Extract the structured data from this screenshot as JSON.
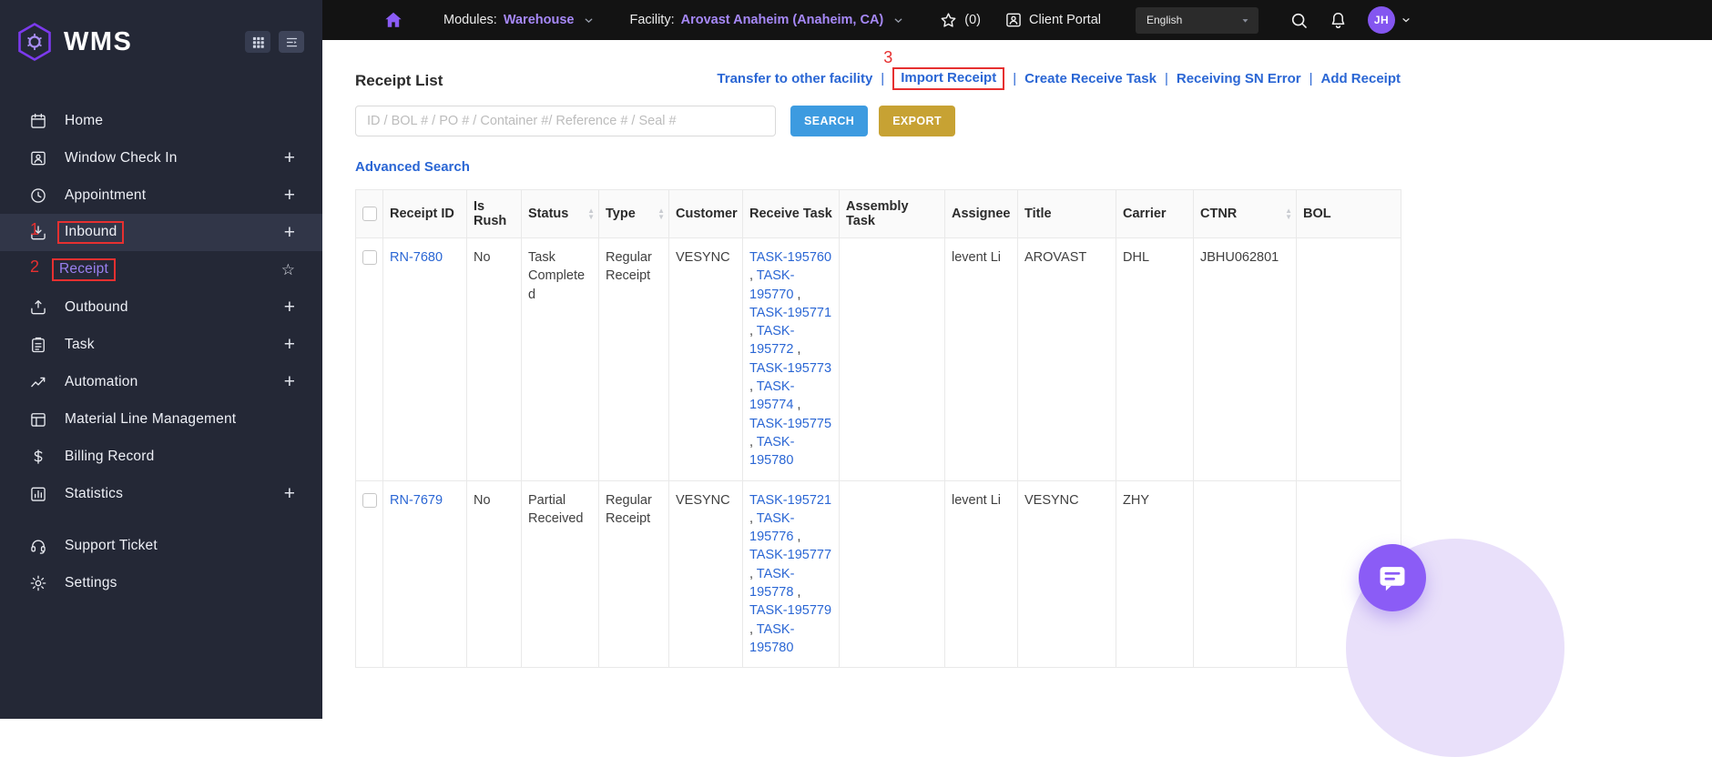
{
  "brand": {
    "name": "WMS"
  },
  "topbar": {
    "modules_label": "Modules:",
    "modules_value": "Warehouse",
    "facility_label": "Facility:",
    "facility_value": "Arovast Anaheim (Anaheim, CA)",
    "favorites_count": "(0)",
    "client_portal_label": "Client Portal",
    "language_selected": "English",
    "user_initials": "JH"
  },
  "sidebar": {
    "items": [
      {
        "label": "Home",
        "icon": "calendar-icon"
      },
      {
        "label": "Window Check In",
        "icon": "window-check-in-icon",
        "plus": true
      },
      {
        "label": "Appointment",
        "icon": "clock-icon",
        "plus": true
      },
      {
        "label": "Inbound",
        "icon": "inbound-icon",
        "plus": true,
        "active": true,
        "annotation": "1"
      },
      {
        "label": "Receipt",
        "sub": true,
        "star": true,
        "annotation": "2"
      },
      {
        "label": "Outbound",
        "icon": "outbound-icon",
        "plus": true
      },
      {
        "label": "Task",
        "icon": "task-icon",
        "plus": true
      },
      {
        "label": "Automation",
        "icon": "automation-icon",
        "plus": true
      },
      {
        "label": "Material Line Management",
        "icon": "material-icon"
      },
      {
        "label": "Billing Record",
        "icon": "billing-icon"
      },
      {
        "label": "Statistics",
        "icon": "statistics-icon",
        "plus": true
      }
    ],
    "footer_items": [
      {
        "label": "Support Ticket",
        "icon": "support-icon"
      },
      {
        "label": "Settings",
        "icon": "settings-icon"
      }
    ]
  },
  "page": {
    "title": "Receipt List",
    "header_links": [
      {
        "label": "Transfer to other facility"
      },
      {
        "label": "Import Receipt",
        "annotation": "3"
      },
      {
        "label": "Create Receive Task"
      },
      {
        "label": "Receiving SN Error"
      },
      {
        "label": "Add Receipt"
      }
    ],
    "search_placeholder": "ID / BOL # / PO # / Container #/ Reference # / Seal #",
    "search_button": "SEARCH",
    "export_button": "EXPORT",
    "advanced_search": "Advanced Search"
  },
  "table": {
    "columns": [
      {
        "label": "Receipt ID"
      },
      {
        "label": "Is Rush"
      },
      {
        "label": "Status",
        "sortable": true
      },
      {
        "label": "Type",
        "sortable": true
      },
      {
        "label": "Customer"
      },
      {
        "label": "Receive Task"
      },
      {
        "label": "Assembly Task"
      },
      {
        "label": "Assignee"
      },
      {
        "label": "Title"
      },
      {
        "label": "Carrier"
      },
      {
        "label": "CTNR",
        "sortable": true
      },
      {
        "label": "BOL"
      }
    ],
    "rows": [
      {
        "receipt_id": "RN-7680",
        "is_rush": "No",
        "status": "Task Completed",
        "type": "Regular Receipt",
        "customer": "VESYNC",
        "receive_tasks": [
          "TASK-195760",
          "TASK-195770",
          "TASK-195771",
          "TASK-195772",
          "TASK-195773",
          "TASK-195774",
          "TASK-195775",
          "TASK-195780"
        ],
        "assembly_task": "",
        "assignee": "levent Li",
        "title": "AROVAST",
        "carrier": "DHL",
        "ctnr": "JBHU062801",
        "bol": ""
      },
      {
        "receipt_id": "RN-7679",
        "is_rush": "No",
        "status": "Partial Received",
        "type": "Regular Receipt",
        "customer": "VESYNC",
        "receive_tasks": [
          "TASK-195721",
          "TASK-195776",
          "TASK-195777",
          "TASK-195778",
          "TASK-195779",
          "TASK-195780"
        ],
        "assembly_task": "",
        "assignee": "levent Li",
        "title": "VESYNC",
        "carrier": "ZHY",
        "ctnr": "",
        "bol": ""
      }
    ]
  }
}
